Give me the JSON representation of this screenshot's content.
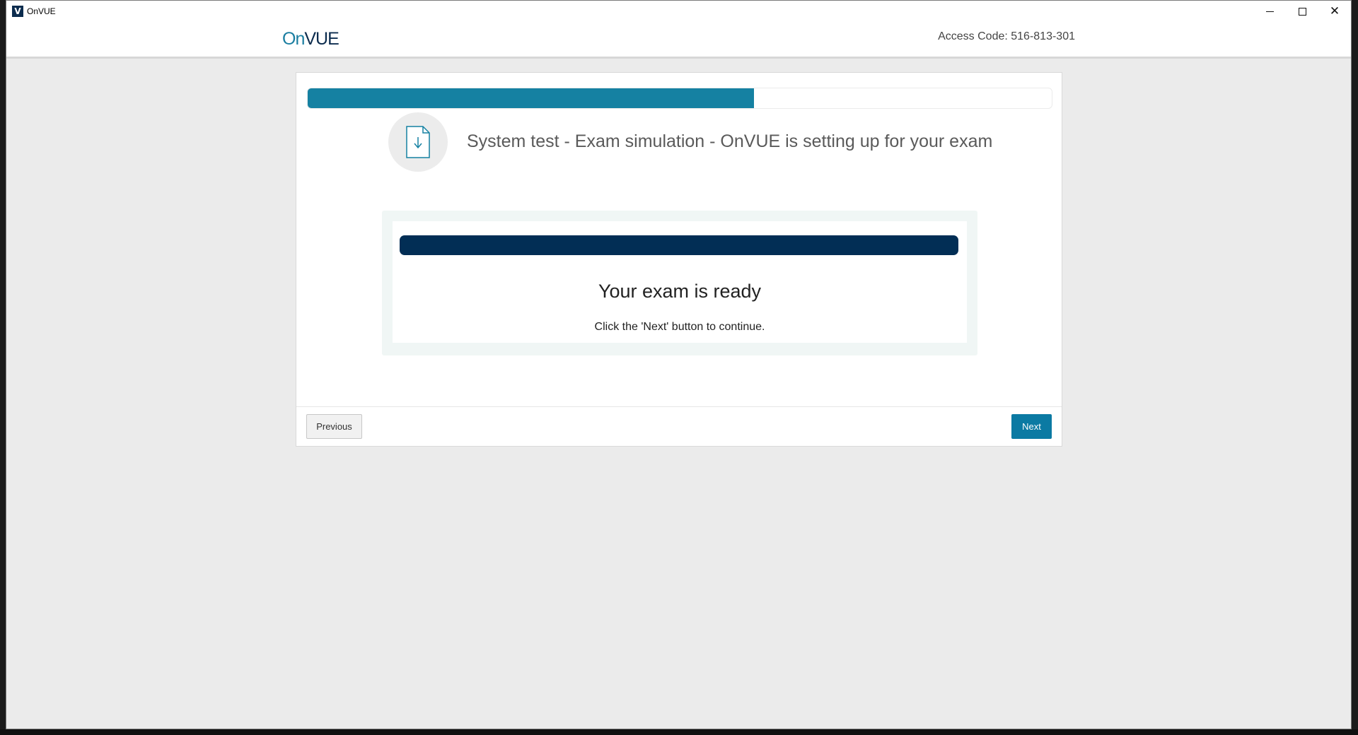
{
  "window": {
    "title": "OnVUE",
    "app_icon_letter": "V"
  },
  "header": {
    "logo_on": "On",
    "logo_vue": "VUE",
    "access_code": "Access Code: 516-813-301"
  },
  "wizard": {
    "progress_percent": 60,
    "step_icon": "document-download-icon",
    "step_title": "System test - Exam simulation - OnVUE is setting up for your exam",
    "status_title": "Your exam is ready",
    "status_subtitle": "Click the 'Next' button to continue.",
    "previous_label": "Previous",
    "next_label": "Next"
  },
  "colors": {
    "progress_fill": "#1581a2",
    "ready_bar": "#022e55",
    "next_button": "#0b7aa3",
    "logo_dark": "#0c2c4e",
    "logo_light": "#1b7ea1"
  }
}
